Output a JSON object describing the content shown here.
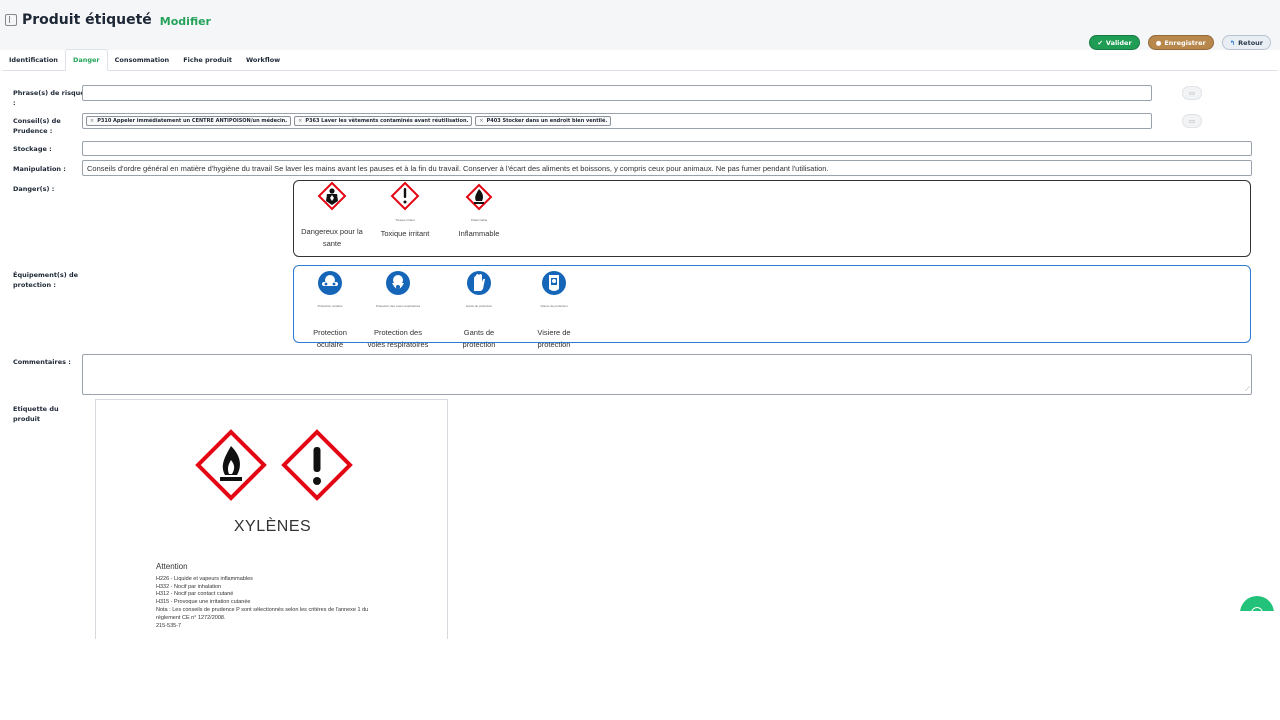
{
  "header": {
    "title": "Produit étiqueté",
    "mode": "Modifier"
  },
  "actions": {
    "valider": "Valider",
    "enregistrer": "Enregistrer",
    "retour": "Retour"
  },
  "tabs": [
    {
      "label": "Identification"
    },
    {
      "label": "Danger"
    },
    {
      "label": "Consommation"
    },
    {
      "label": "Fiche produit"
    },
    {
      "label": "Workflow"
    }
  ],
  "form": {
    "risk_label_1": "Phrase(s) de risque",
    "risk_label_2": ":",
    "prudence_label_1": "Conseil(s) de",
    "prudence_label_2": "Prudence :",
    "prudence_chips": [
      "P310 Appeler immédiatement un CENTRE ANTIPOISON/un médecin.",
      "P363 Laver les vêtements contaminés avant réutilisation.",
      "P403 Stocker dans un endroit bien ventilé."
    ],
    "stockage_label": "Stockage :",
    "manipulation_label": "Manipulation :",
    "manipulation_value": "Conseils d'ordre général en matière d'hygiène du travail Se laver les mains avant les pauses et à la fin du travail. Conserver à l'écart des aliments et boissons, y compris ceux pour animaux. Ne pas fumer pendant l'utilisation.",
    "dangers_label": "Danger(s) :",
    "equip_label_1": "Équipement(s) de",
    "equip_label_2": "protection :",
    "comment_label": "Commentaires :",
    "etiquette_label_1": "Etiquette du",
    "etiquette_label_2": "produit"
  },
  "dangers": [
    {
      "icon": "health-hazard-icon",
      "line1": "Dangereux pour la",
      "line2": "sante",
      "tiny": ""
    },
    {
      "icon": "exclamation-hazard-icon",
      "line1": "Toxique irritant",
      "line2": "",
      "tiny": "Toxique irritant"
    },
    {
      "icon": "flame-hazard-icon",
      "line1": "Inflammable",
      "line2": "",
      "tiny": "Inflammable"
    }
  ],
  "equipments": [
    {
      "icon": "goggles-icon",
      "line1": "Protection",
      "line2": "oculaire",
      "tiny": "Protection oculaire"
    },
    {
      "icon": "respirator-icon",
      "line1": "Protection des",
      "line2": "voies respiratoires",
      "tiny": "Protection des voies respiratoires"
    },
    {
      "icon": "gloves-icon",
      "line1": "Gants de",
      "line2": "protection",
      "tiny": "Gants de protection"
    },
    {
      "icon": "face-shield-icon",
      "line1": "Visiere de",
      "line2": "protection",
      "tiny": "Visiere de protection"
    }
  ],
  "label": {
    "product": "XYLÈNES",
    "signal": "Attention",
    "lines": [
      "H226 - Liquide et vapeurs inflammables",
      "H332 - Nocif par inhalation",
      "H312 - Nocif par contact cutané",
      "H315 - Provoque une irritation cutanée",
      "Nota : Les conseils de prudence P sont sélectionnés selon les critères de l'annexe 1 du",
      "règlement CE n° 1272/2008.",
      "215-535-7"
    ]
  },
  "colors": {
    "green": "#25a35a",
    "hazard_red": "#e30613",
    "mandatory_blue": "#1565b8",
    "panel_blue": "#2a7cd3"
  }
}
